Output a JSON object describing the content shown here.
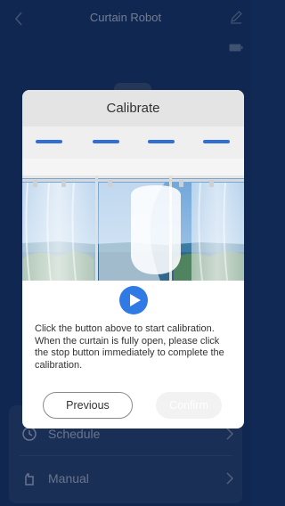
{
  "app": {
    "title": "Curtain Robot",
    "menu": [
      {
        "label": "Schedule",
        "icon": "clock-icon"
      },
      {
        "label": "Manual",
        "icon": "hand-icon"
      }
    ]
  },
  "dialog": {
    "title": "Calibrate",
    "step_count": 4,
    "current_step": 4,
    "instructions": "Click the button above to start calibration. When the curtain is fully open, please click the stop button immediately to complete the calibration.",
    "previous_label": "Previous",
    "confirm_label": "Confirm",
    "confirm_enabled": false
  },
  "colors": {
    "app_background": "#173a73",
    "accent": "#2f7ae5",
    "step_indicator": "#2f6fd6"
  },
  "icons": {
    "play": "play-icon",
    "back": "back-chevron-icon",
    "edit": "edit-pencil-icon",
    "battery": "battery-icon"
  }
}
